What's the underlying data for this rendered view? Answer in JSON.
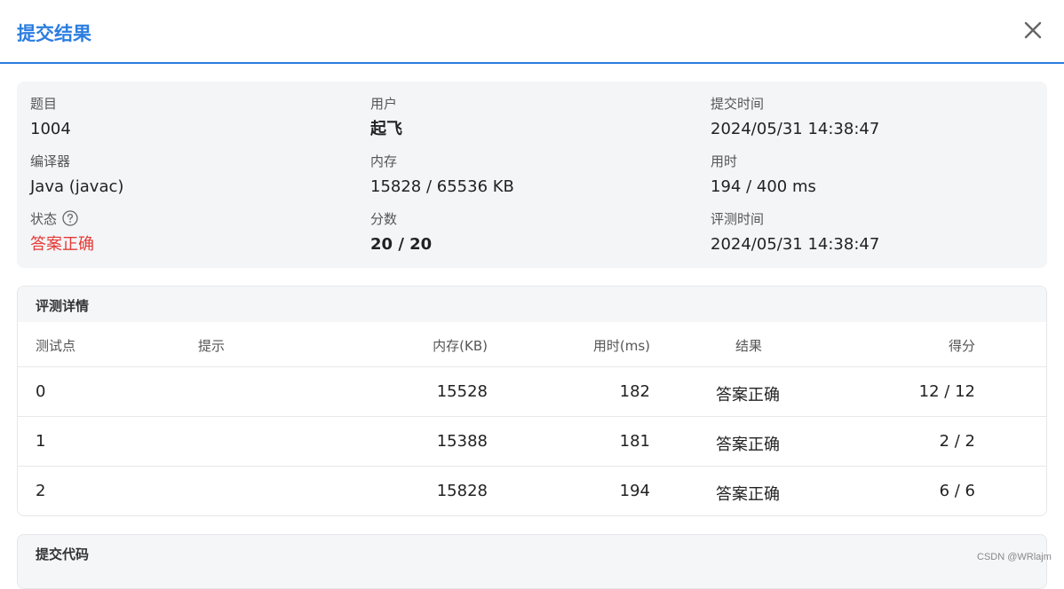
{
  "dialog": {
    "title": "提交结果"
  },
  "info": {
    "problem_label": "题目",
    "problem_value": "1004",
    "user_label": "用户",
    "user_value": "起飞",
    "submit_time_label": "提交时间",
    "submit_time_value": "2024/05/31 14:38:47",
    "compiler_label": "编译器",
    "compiler_value": "Java (javac)",
    "memory_label": "内存",
    "memory_value": "15828 / 65536 KB",
    "time_label": "用时",
    "time_value": "194 / 400 ms",
    "status_label": "状态",
    "status_value": "答案正确",
    "score_label": "分数",
    "score_value": "20 / 20",
    "judge_time_label": "评测时间",
    "judge_time_value": "2024/05/31 14:38:47"
  },
  "details": {
    "title": "评测详情",
    "headers": [
      "测试点",
      "提示",
      "内存(KB)",
      "用时(ms)",
      "结果",
      "得分"
    ],
    "rows": [
      {
        "id": "0",
        "hint": "",
        "memory": "15528",
        "time": "182",
        "result": "答案正确",
        "score": "12 / 12"
      },
      {
        "id": "1",
        "hint": "",
        "memory": "15388",
        "time": "181",
        "result": "答案正确",
        "score": "2 / 2"
      },
      {
        "id": "2",
        "hint": "",
        "memory": "15828",
        "time": "194",
        "result": "答案正确",
        "score": "6 / 6"
      }
    ]
  },
  "code": {
    "title": "提交代码"
  },
  "watermark": "CSDN @WRlajm",
  "colors": {
    "accent": "#2b7de0",
    "success_text": "#e53935",
    "card_bg": "#f4f5f7"
  }
}
